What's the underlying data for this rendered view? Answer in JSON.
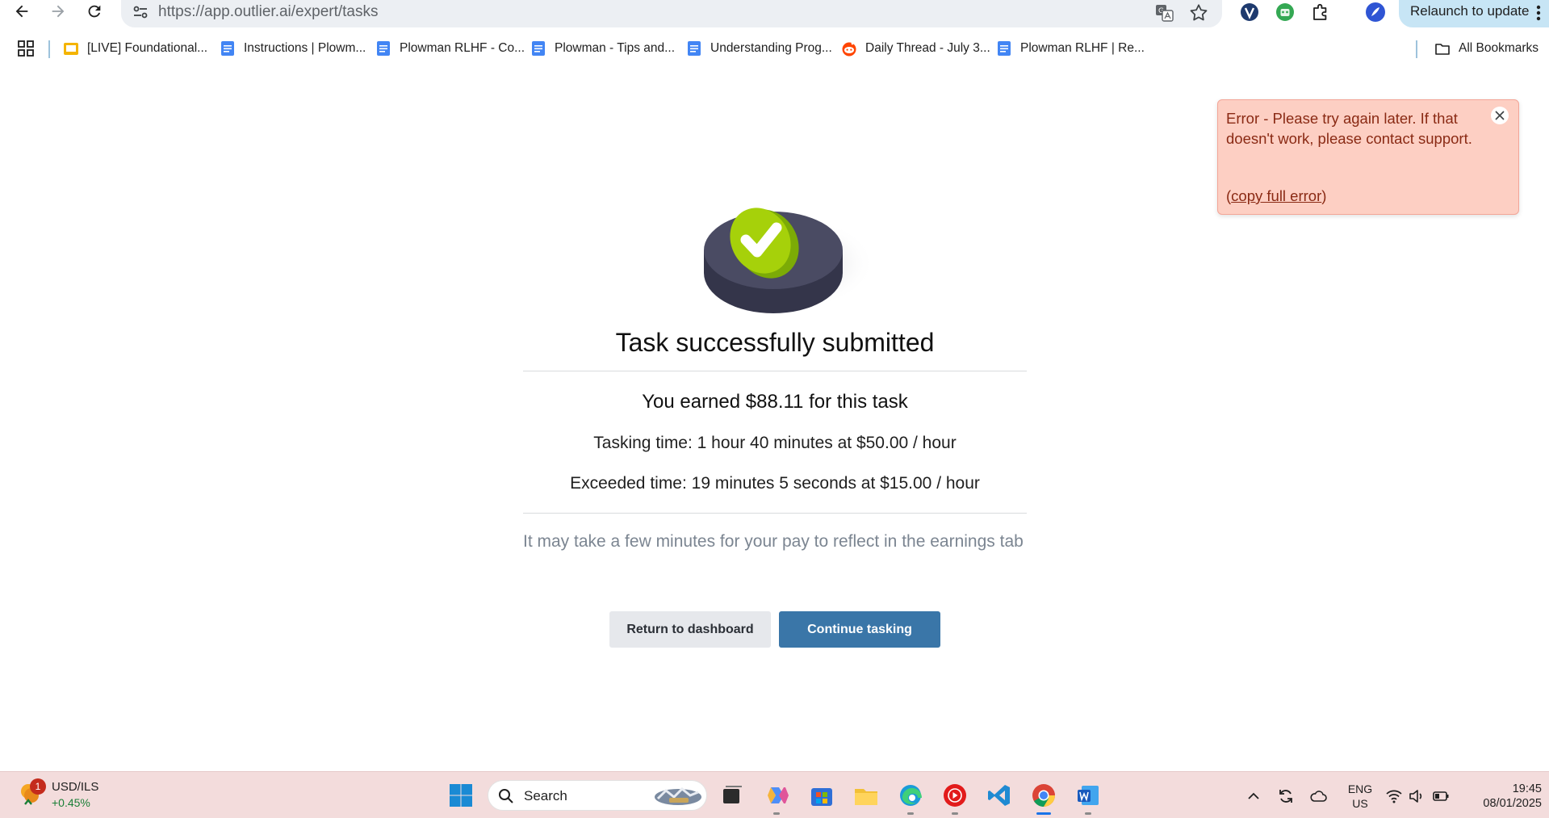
{
  "browser": {
    "url": "https://app.outlier.ai/expert/tasks",
    "relaunch_label": "Relaunch to update"
  },
  "bookmarks": {
    "items": [
      {
        "label": "[LIVE] Foundational...",
        "icon": "slides-icon"
      },
      {
        "label": "Instructions | Plowm...",
        "icon": "docs-icon"
      },
      {
        "label": "Plowman RLHF - Co...",
        "icon": "docs-icon"
      },
      {
        "label": "Plowman - Tips and...",
        "icon": "docs-icon"
      },
      {
        "label": "Understanding Prog...",
        "icon": "docs-icon"
      },
      {
        "label": "Daily Thread - July 3...",
        "icon": "reddit-icon"
      },
      {
        "label": "Plowman RLHF | Re...",
        "icon": "docs-icon"
      }
    ],
    "all_bookmarks_label": "All Bookmarks"
  },
  "main": {
    "title": "Task successfully submitted",
    "earned": "You earned $88.11 for this task",
    "tasking_time": "Tasking time: 1 hour 40 minutes at $50.00 / hour",
    "exceeded_time": "Exceeded time: 19 minutes 5 seconds at $15.00 / hour",
    "note": "It may take a few minutes for your pay to reflect in the earnings tab",
    "return_button": "Return to dashboard",
    "continue_button": "Continue tasking"
  },
  "toast": {
    "message": "Error - Please try again later. If that doesn't work, please contact support.",
    "link_open": "(",
    "link_text": "copy full error",
    "link_close": ")"
  },
  "taskbar": {
    "widget_badge": "1",
    "widget_name": "USD/ILS",
    "widget_change": "+0.45%",
    "search_placeholder": "Search",
    "lang_line1": "ENG",
    "lang_line2": "US",
    "time": "19:45",
    "date": "08/01/2025"
  },
  "colors": {
    "primary_button": "#3a76a8",
    "toast_background": "#fdcfc3",
    "toast_text": "#8a2a14",
    "check_green": "#a6d10a"
  }
}
